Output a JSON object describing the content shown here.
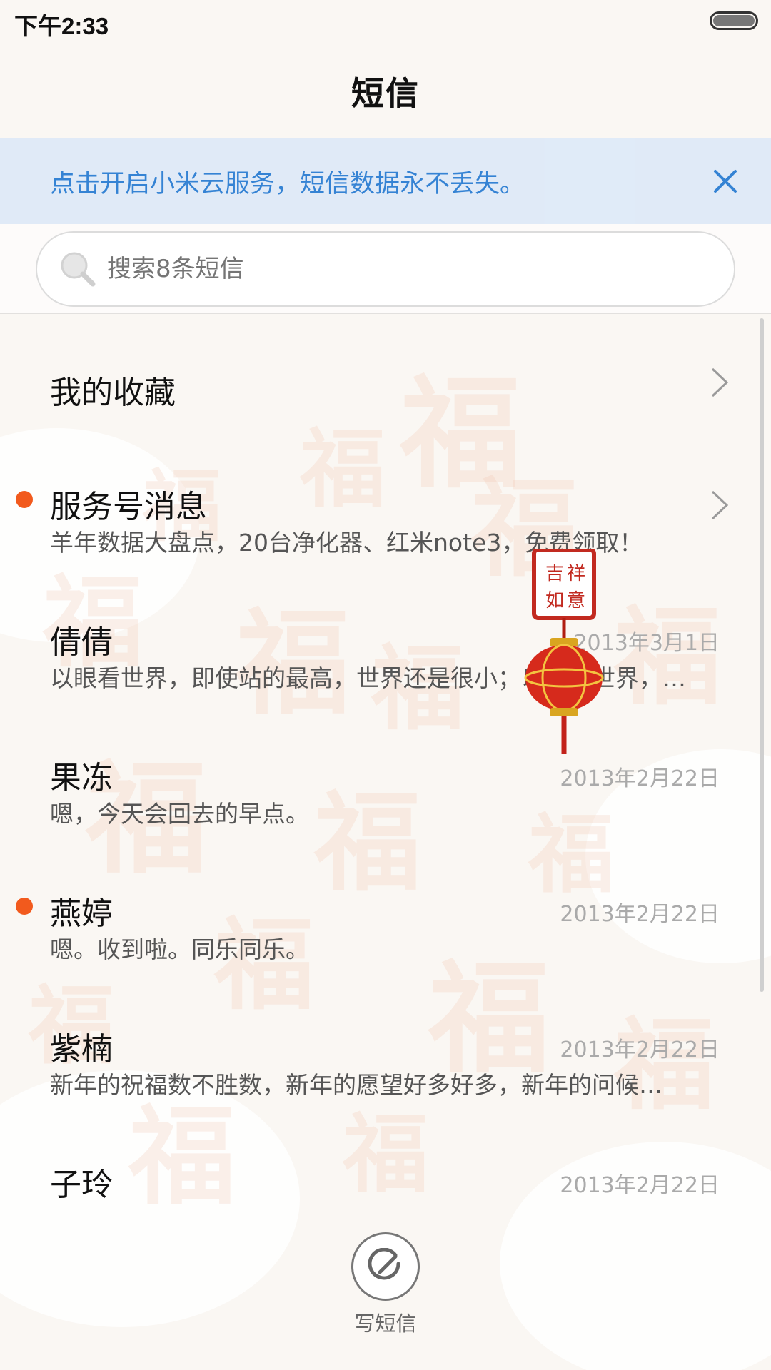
{
  "status_bar": {
    "time": "下午2:33",
    "battery_icon": "battery-icon"
  },
  "header": {
    "title": "短信"
  },
  "cloud_banner": {
    "text": "点击开启小米云服务，短信数据永不丢失。",
    "close_icon": "close-icon",
    "color": "#2d7fd3"
  },
  "search": {
    "placeholder": "搜索8条短信",
    "icon": "search-icon"
  },
  "list": {
    "favorites": {
      "label": "我的收藏"
    },
    "service": {
      "name": "服务号消息",
      "preview": "羊年数据大盘点，20台净化器、红米note3，免费领取！",
      "unread": true
    },
    "conversations": [
      {
        "name": "倩倩",
        "preview": "以眼看世界，即使站的最高，世界还是很小；以心看世界，…",
        "date": "2013年3月1日",
        "unread": false
      },
      {
        "name": "果冻",
        "preview": "嗯，今天会回去的早点。",
        "date": "2013年2月22日",
        "unread": false
      },
      {
        "name": "燕婷",
        "preview": "嗯。收到啦。同乐同乐。",
        "date": "2013年2月22日",
        "unread": true
      },
      {
        "name": "紫楠",
        "preview": "新年的祝福数不胜数，新年的愿望好多好多，新年的问候…",
        "date": "2013年2月22日",
        "unread": false
      },
      {
        "name": "子玲",
        "preview": "",
        "date": "2013年2月22日",
        "unread": false
      }
    ]
  },
  "compose": {
    "label": "写短信",
    "icon": "compose-icon"
  },
  "colors": {
    "unread_dot": "#f25a1d",
    "banner_bg": "#dfeaf8"
  }
}
